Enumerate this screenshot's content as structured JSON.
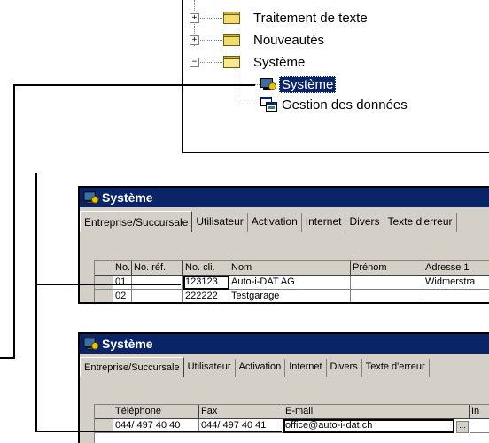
{
  "tree": {
    "items": [
      {
        "label": "Traitement de texte",
        "expander": "+"
      },
      {
        "label": "Nouveautés",
        "expander": "+"
      },
      {
        "label": "Système",
        "expander": "−"
      },
      {
        "label": "Système"
      },
      {
        "label": "Gestion des données"
      }
    ]
  },
  "window1": {
    "title": "Système",
    "tabs": [
      "Entreprise/Succursale",
      "Utilisateur",
      "Activation",
      "Internet",
      "Divers",
      "Texte d'erreur"
    ],
    "columns": [
      "No.",
      "No. réf.",
      "No. cli.",
      "Nom",
      "Prénom",
      "Adresse 1"
    ],
    "rows": [
      [
        "01",
        "",
        "123123",
        "Auto-i-DAT AG",
        "",
        "Widmerstra"
      ],
      [
        "02",
        "",
        "222222",
        "Testgarage",
        "",
        ""
      ]
    ]
  },
  "window2": {
    "title": "Système",
    "tabs": [
      "Entreprise/Succursale",
      "Utilisateur",
      "Activation",
      "Internet",
      "Divers",
      "Texte d'erreur"
    ],
    "columns": [
      "Téléphone",
      "Fax",
      "E-mail",
      "In"
    ],
    "rows": [
      [
        "044/ 497 40 40",
        "044/ 497 40 41",
        "office@auto-i-dat.ch",
        "..."
      ]
    ]
  }
}
